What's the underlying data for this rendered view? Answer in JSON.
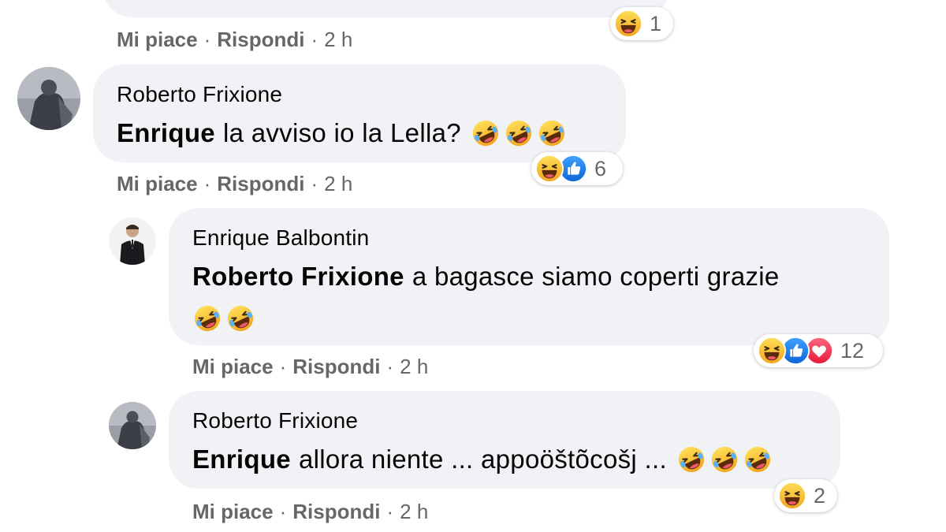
{
  "comments": [
    {
      "id": "c0",
      "reactions": {
        "icons": [
          "haha"
        ],
        "count": "1"
      },
      "actions": {
        "like": "Mi piace",
        "reply": "Rispondi",
        "time": "2 h"
      }
    },
    {
      "id": "c1",
      "author": "Roberto Frixione",
      "mention": "Enrique",
      "text": "la avviso io la Lella?",
      "inline_emoji": [
        "rofl",
        "rofl",
        "rofl"
      ],
      "reactions": {
        "icons": [
          "haha",
          "like"
        ],
        "count": "6"
      },
      "actions": {
        "like": "Mi piace",
        "reply": "Rispondi",
        "time": "2 h"
      }
    },
    {
      "id": "c2",
      "author": "Enrique Balbontin",
      "mention": "Roberto Frixione",
      "text": "a bagasce siamo coperti grazie",
      "inline_emoji": [
        "rofl",
        "rofl"
      ],
      "reactions": {
        "icons": [
          "haha",
          "like",
          "love"
        ],
        "count": "12"
      },
      "actions": {
        "like": "Mi piace",
        "reply": "Rispondi",
        "time": "2 h"
      }
    },
    {
      "id": "c3",
      "author": "Roberto Frixione",
      "mention": "Enrique",
      "text": "allora niente ... appoöštõcošj ...",
      "inline_emoji": [
        "rofl",
        "rofl",
        "rofl"
      ],
      "reactions": {
        "icons": [
          "haha"
        ],
        "count": "2"
      },
      "actions": {
        "like": "Mi piace",
        "reply": "Rispondi",
        "time": "2 h"
      }
    }
  ],
  "colors": {
    "bubble": "#f0f2f5",
    "meta_text": "#65676b",
    "like_blue": "#1877f2",
    "love_red": "#f33e58",
    "emoji_yellow": "#f7b125"
  }
}
